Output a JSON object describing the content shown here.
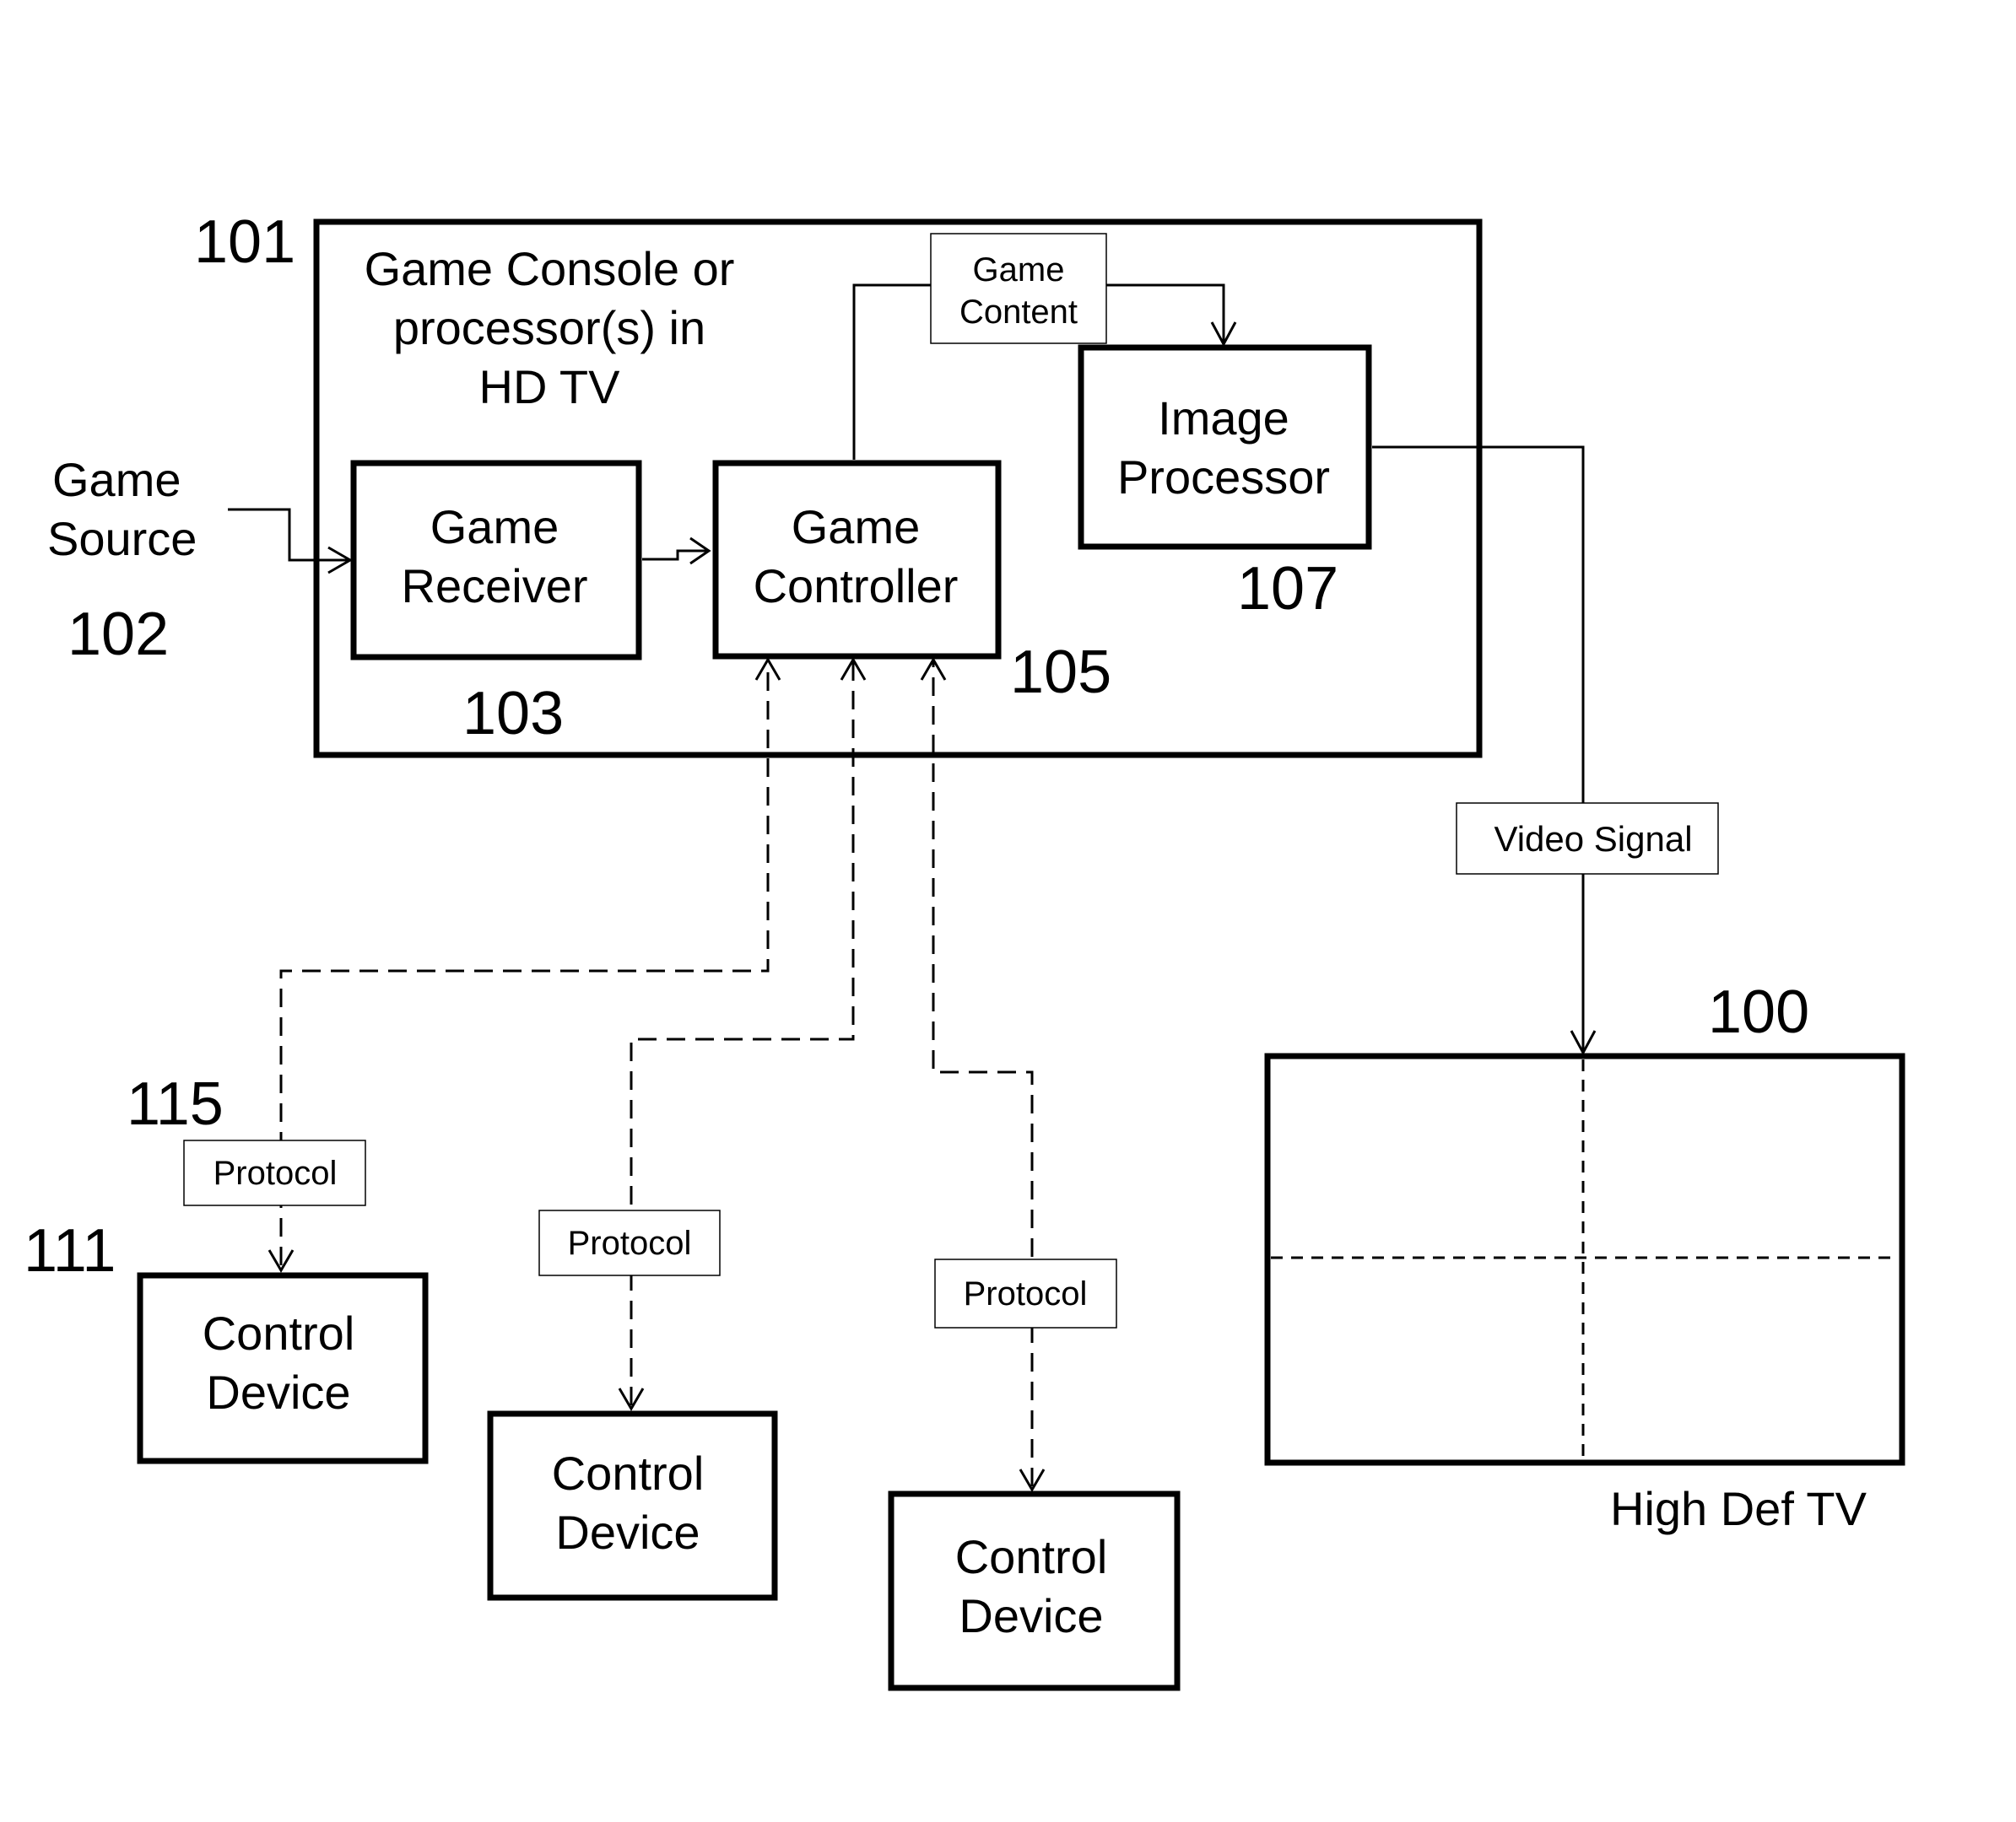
{
  "figure": {
    "console": {
      "ref": "101",
      "title_lines": [
        "Game Console or",
        "processor(s) in",
        "HD TV"
      ]
    },
    "game_source": {
      "label_lines": [
        "Game",
        "Source"
      ],
      "ref": "102"
    },
    "game_receiver": {
      "label_lines": [
        "Game",
        "Receiver"
      ],
      "ref": "103"
    },
    "game_controller": {
      "label_lines": [
        "Game",
        "Controller"
      ],
      "ref": "105"
    },
    "image_processor": {
      "label_lines": [
        "Image",
        "Processor"
      ],
      "ref": "107"
    },
    "game_content_label": [
      "Game",
      "Content"
    ],
    "video_signal_label": "Video Signal",
    "tv": {
      "ref": "100",
      "caption": "High Def TV"
    },
    "protocol_ref": "115",
    "control_device_ref": "111",
    "links": [
      {
        "protocol_label": "Protocol",
        "device_label_lines": [
          "Control",
          "Device"
        ]
      },
      {
        "protocol_label": "Protocol",
        "device_label_lines": [
          "Control",
          "Device"
        ]
      },
      {
        "protocol_label": "Protocol",
        "device_label_lines": [
          "Control",
          "Device"
        ]
      }
    ]
  }
}
